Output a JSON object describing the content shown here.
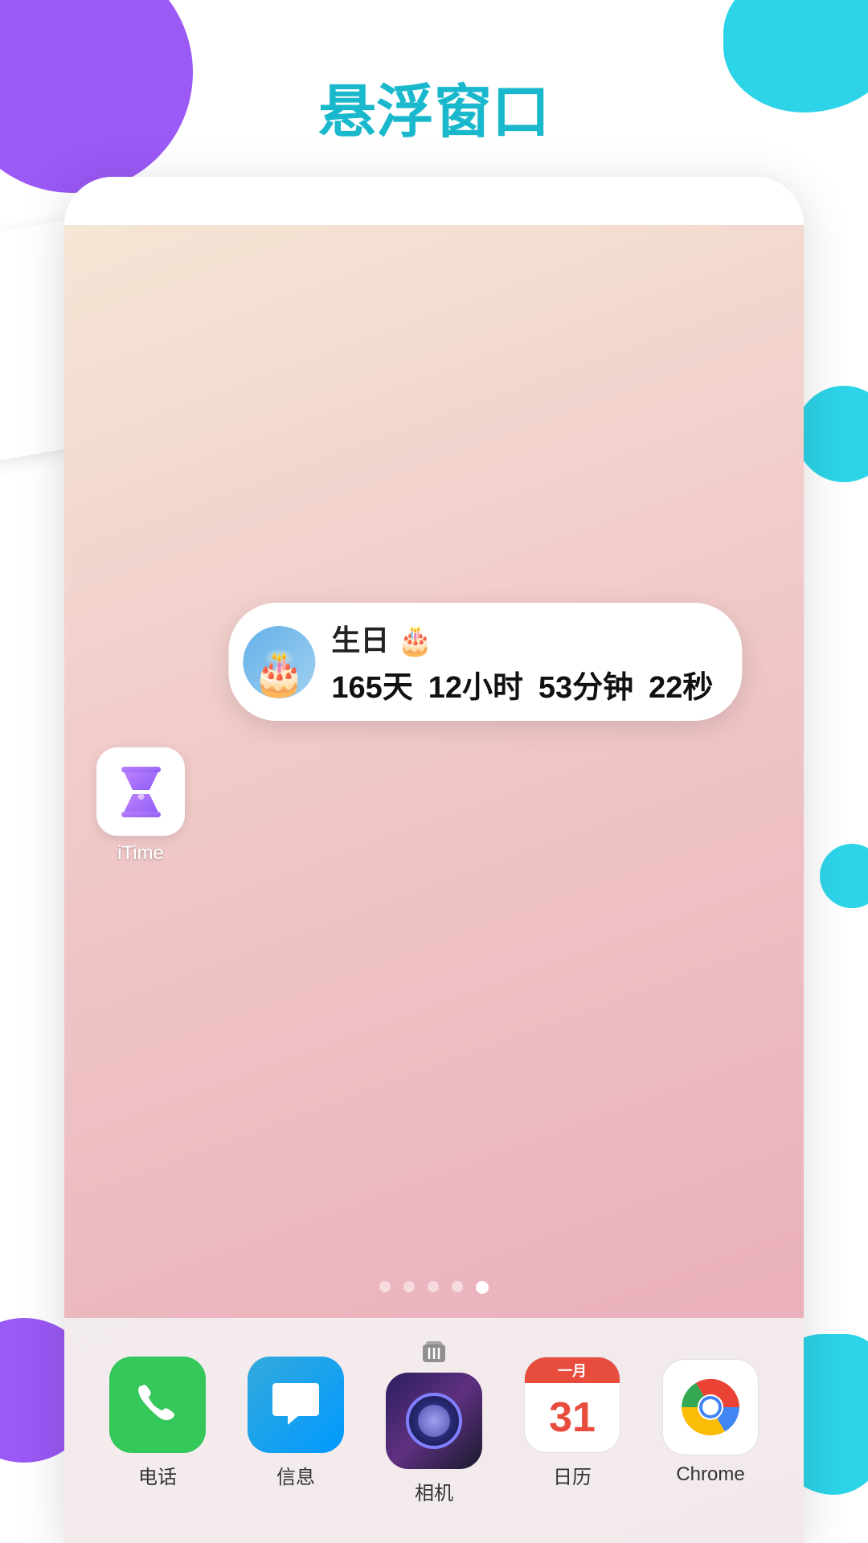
{
  "page": {
    "title": "悬浮窗口",
    "background_blobs": [
      "purple",
      "cyan"
    ]
  },
  "widget": {
    "title": "生日 🎂",
    "countdown": {
      "days": "165天",
      "hours": "12小时",
      "minutes": "53分钟",
      "seconds": "22秒"
    }
  },
  "home_app": {
    "name": "iTime",
    "label": "iTime"
  },
  "page_dots": {
    "total": 5,
    "active": 4
  },
  "dock": {
    "apps": [
      {
        "id": "phone",
        "label": "电话",
        "emoji": "📞"
      },
      {
        "id": "messages",
        "label": "信息",
        "emoji": "💬"
      },
      {
        "id": "camera",
        "label": "相机",
        "emoji": "📷"
      },
      {
        "id": "calendar",
        "label": "日历",
        "emoji": "31"
      },
      {
        "id": "chrome",
        "label": "Chrome",
        "emoji": "🌐"
      }
    ]
  }
}
